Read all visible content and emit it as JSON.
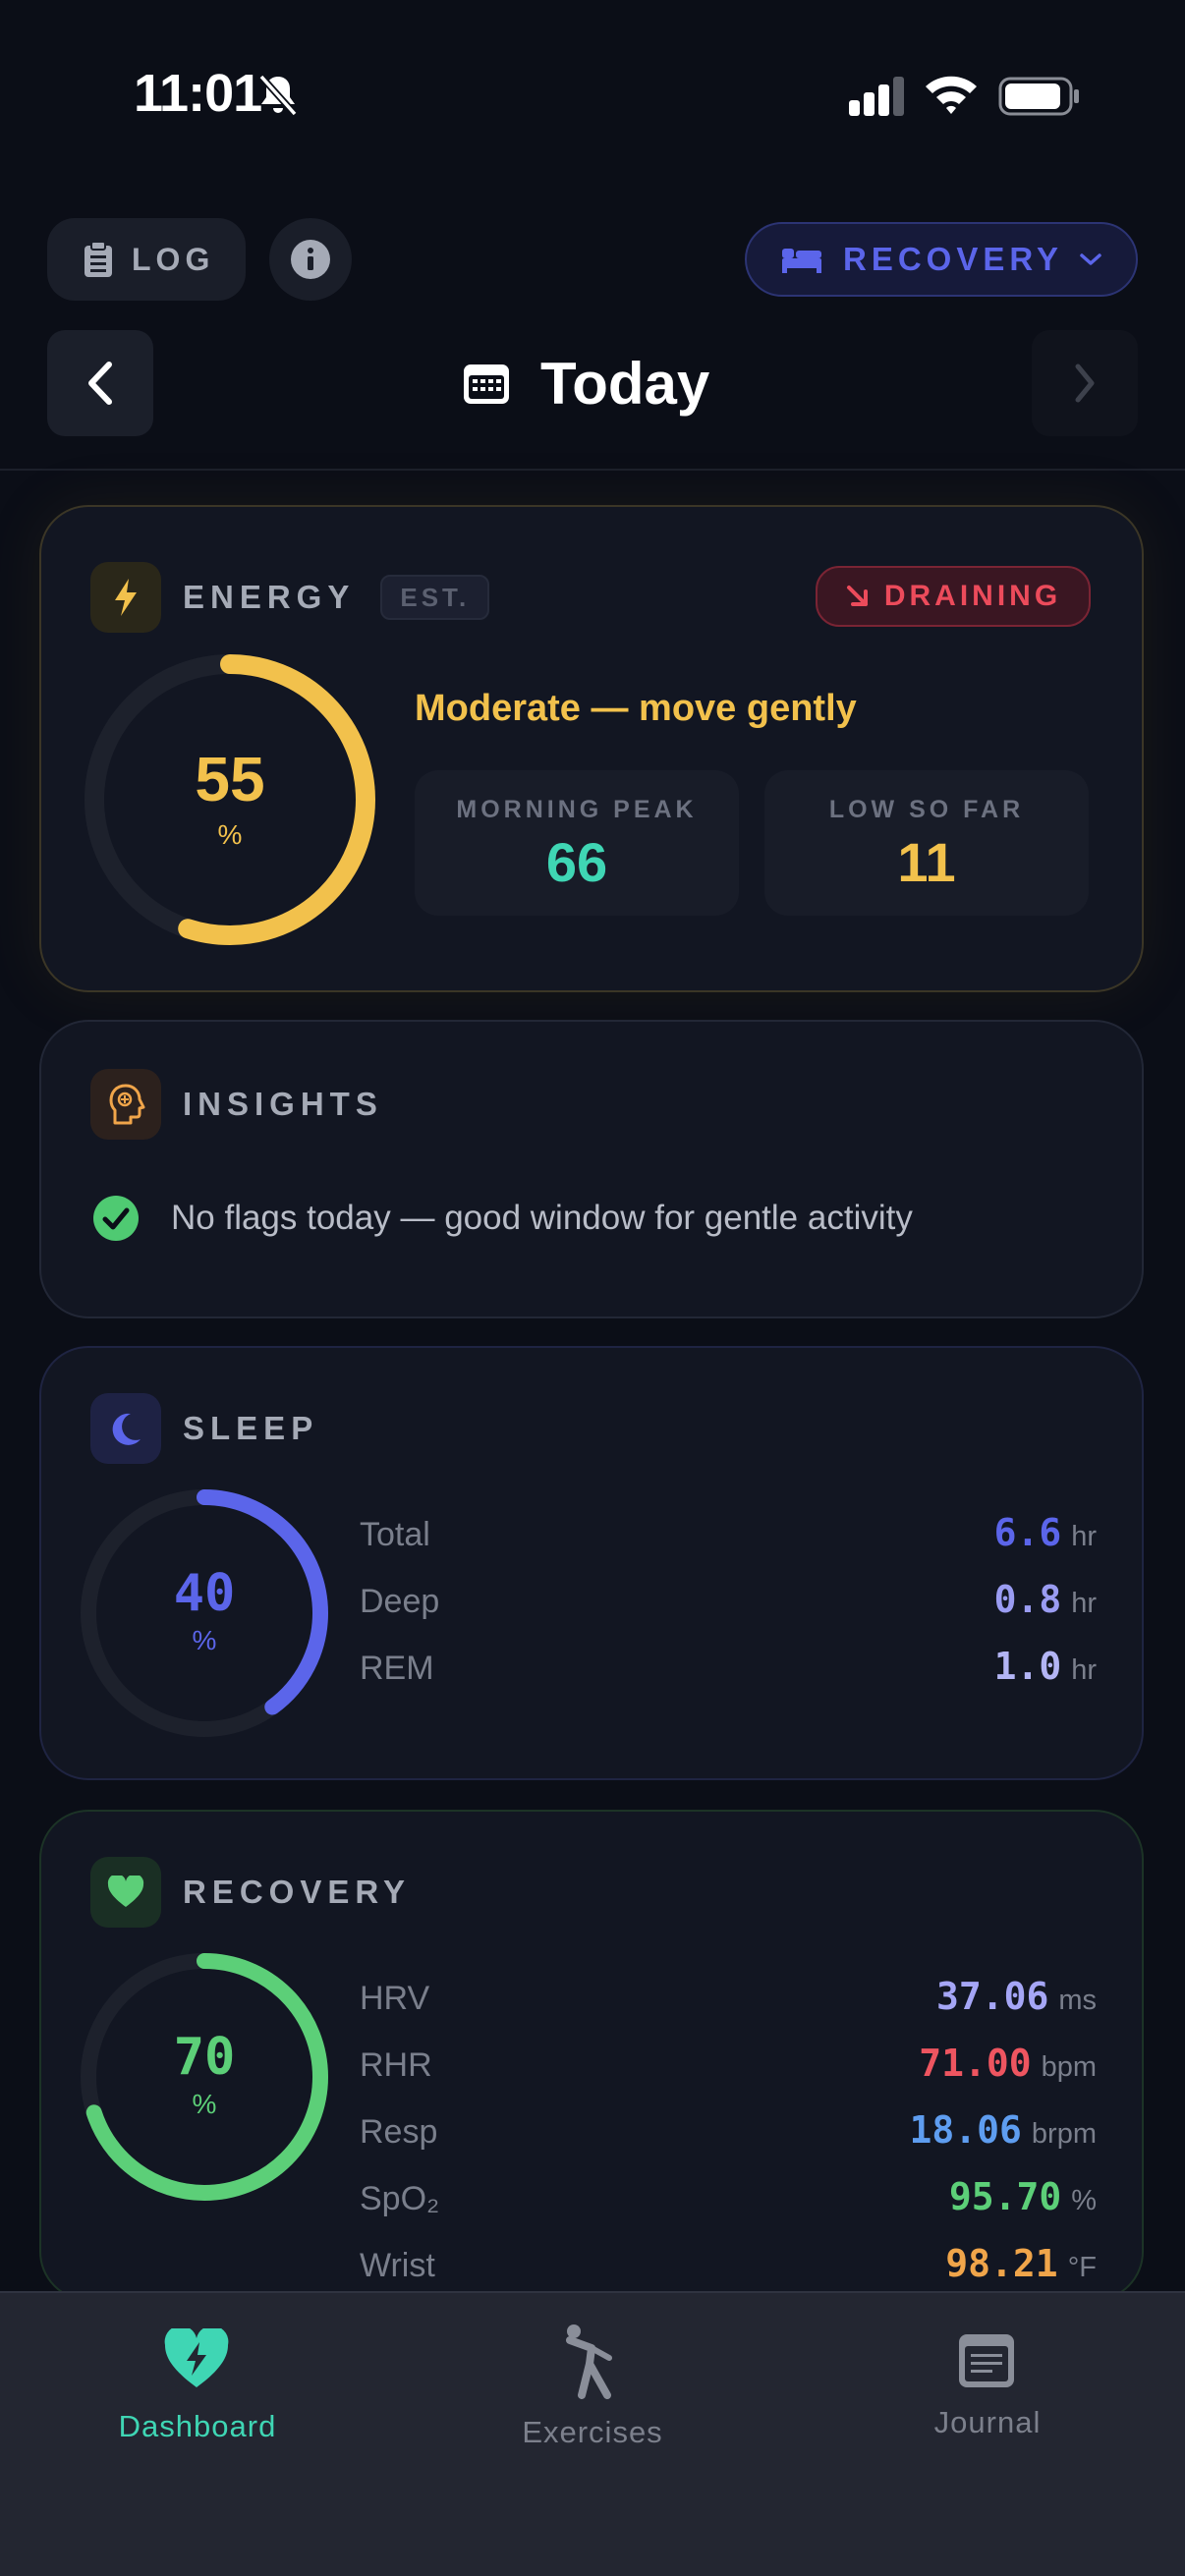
{
  "status_bar": {
    "time": "11:01"
  },
  "header": {
    "log_label": "LOG",
    "mode_label": "RECOVERY",
    "date_title": "Today"
  },
  "energy": {
    "title": "ENERGY",
    "badge": "EST.",
    "trend": "DRAINING",
    "value": "55",
    "unit": "%",
    "fraction": 0.55,
    "status": "Moderate — move gently",
    "morning_peak_label": "MORNING PEAK",
    "morning_peak": "66",
    "low_label": "LOW SO FAR",
    "low": "11",
    "colors": {
      "ring": "#f2c14c",
      "peak": "#3fd6b4",
      "low": "#f2c14c",
      "trend": "#ec4b5b"
    }
  },
  "insights": {
    "title": "INSIGHTS",
    "message": "No flags today — good window for gentle activity"
  },
  "sleep": {
    "title": "SLEEP",
    "value": "40",
    "unit": "%",
    "fraction": 0.4,
    "rows": [
      {
        "label": "Total",
        "value": "6.6",
        "unit": "hr",
        "color": "#5b65ea"
      },
      {
        "label": "Deep",
        "value": "0.8",
        "unit": "hr",
        "color": "#9a9cf2"
      },
      {
        "label": "REM",
        "value": "1.0",
        "unit": "hr",
        "color": "#b3b5f5"
      }
    ]
  },
  "recovery": {
    "title": "RECOVERY",
    "value": "70",
    "unit": "%",
    "fraction": 0.7,
    "rows": [
      {
        "label": "HRV",
        "value": "37.06",
        "unit": "ms",
        "color": "#a5a6f6"
      },
      {
        "label": "RHR",
        "value": "71.00",
        "unit": "bpm",
        "color": "#ee5560"
      },
      {
        "label": "Resp",
        "value": "18.06",
        "unit": "brpm",
        "color": "#5e9df0"
      },
      {
        "label": "SpO₂",
        "value": "95.70",
        "unit": "%",
        "color": "#5ccf78"
      },
      {
        "label": "Wrist",
        "value": "98.21",
        "unit": "°F",
        "color": "#f0a54a"
      }
    ]
  },
  "tabs": [
    {
      "label": "Dashboard",
      "icon": "heart-bolt-icon",
      "active": true
    },
    {
      "label": "Exercises",
      "icon": "stretching-figure-icon",
      "active": false
    },
    {
      "label": "Journal",
      "icon": "notepad-icon",
      "active": false
    }
  ],
  "colors": {
    "accent": "#3fd6b4",
    "mode": "#5b65ea",
    "sleep": "#5b65ea",
    "recovery": "#5ccf78"
  }
}
